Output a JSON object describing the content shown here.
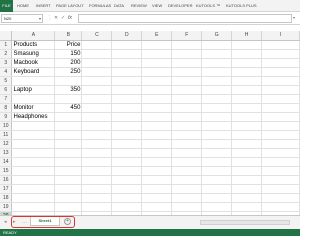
{
  "ribbon": {
    "file_label": "FILE",
    "tabs": [
      "HOME",
      "INSERT",
      "PAGE LAYOUT",
      "FORMULAS",
      "DATA",
      "REVIEW",
      "VIEW",
      "DEVELOPER",
      "KUTOOLS ™",
      "KUTOOLS PLUS"
    ]
  },
  "formula_bar": {
    "name_box": "N20",
    "fx_label": "fx",
    "cancel_glyph": "✕",
    "enter_glyph": "✓",
    "dots_glyph": "⋮",
    "formula_value": ""
  },
  "grid": {
    "columns": [
      "A",
      "B",
      "C",
      "D",
      "E",
      "F",
      "G",
      "H",
      "I"
    ],
    "active_row": "20",
    "rows": [
      {
        "num": "1",
        "a": "Products",
        "b": "Price"
      },
      {
        "num": "2",
        "a": "Smasung",
        "b": "150"
      },
      {
        "num": "3",
        "a": "Macbook",
        "b": "200"
      },
      {
        "num": "4",
        "a": "Keyboard",
        "b": "250"
      },
      {
        "num": "5",
        "a": "",
        "b": ""
      },
      {
        "num": "6",
        "a": "Laptop",
        "b": "350"
      },
      {
        "num": "7",
        "a": "",
        "b": ""
      },
      {
        "num": "8",
        "a": "Monitor",
        "b": "450"
      },
      {
        "num": "9",
        "a": "Headphones",
        "b": ""
      },
      {
        "num": "10",
        "a": "",
        "b": ""
      },
      {
        "num": "11",
        "a": "",
        "b": ""
      },
      {
        "num": "12",
        "a": "",
        "b": ""
      },
      {
        "num": "13",
        "a": "",
        "b": ""
      },
      {
        "num": "14",
        "a": "",
        "b": ""
      },
      {
        "num": "15",
        "a": "",
        "b": ""
      },
      {
        "num": "16",
        "a": "",
        "b": ""
      },
      {
        "num": "17",
        "a": "",
        "b": ""
      },
      {
        "num": "18",
        "a": "",
        "b": ""
      },
      {
        "num": "19",
        "a": "",
        "b": ""
      },
      {
        "num": "20",
        "a": "",
        "b": ""
      },
      {
        "num": "21",
        "a": "",
        "b": ""
      }
    ]
  },
  "sheet_tabs": {
    "nav_left": "◂",
    "nav_right": "▸",
    "nav_more": "…",
    "sheets": [
      "Sheet1"
    ],
    "add_glyph": "+"
  },
  "status_bar": {
    "mode": "READY"
  },
  "colors": {
    "accent": "#217346",
    "highlight": "#e0332f"
  }
}
